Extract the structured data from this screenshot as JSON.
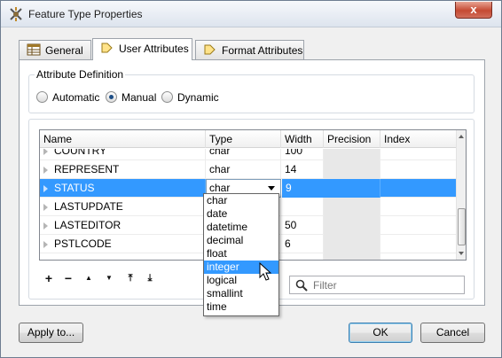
{
  "window": {
    "title": "Feature Type Properties",
    "close_glyph": "x"
  },
  "tabs": [
    {
      "label": "General",
      "icon": "table-icon"
    },
    {
      "label": "User Attributes",
      "icon": "attribute-arrow-icon",
      "active": true
    },
    {
      "label": "Format Attributes",
      "icon": "attribute-arrow-icon"
    }
  ],
  "attribute_definition": {
    "title": "Attribute Definition",
    "options": [
      {
        "label": "Automatic",
        "selected": false
      },
      {
        "label": "Manual",
        "selected": true
      },
      {
        "label": "Dynamic",
        "selected": false
      }
    ]
  },
  "grid": {
    "columns": [
      "Name",
      "Type",
      "Width",
      "Precision",
      "Index"
    ],
    "rows": [
      {
        "name": "COUNTRY",
        "type": "char",
        "width": "100",
        "precision": "",
        "index": ""
      },
      {
        "name": "REPRESENT",
        "type": "char",
        "width": "14",
        "precision": "",
        "index": ""
      },
      {
        "name": "STATUS",
        "type": "char",
        "width": "9",
        "precision": "",
        "index": "",
        "selected": true
      },
      {
        "name": "LASTUPDATE",
        "type": "",
        "width": "",
        "precision": "",
        "index": ""
      },
      {
        "name": "LASTEDITOR",
        "type": "",
        "width": "50",
        "precision": "",
        "index": ""
      },
      {
        "name": "PSTLCODE",
        "type": "",
        "width": "6",
        "precision": "",
        "index": ""
      },
      {
        "name": "",
        "type": "",
        "width": "",
        "precision": "",
        "index": ""
      }
    ]
  },
  "type_dropdown": {
    "options": [
      "char",
      "date",
      "datetime",
      "decimal",
      "float",
      "integer",
      "logical",
      "smallint",
      "time"
    ],
    "highlighted": "integer"
  },
  "toolbar": {
    "add": "+",
    "remove": "−",
    "up": "▲",
    "down": "▼",
    "top": "⤒",
    "bottom": "⤓"
  },
  "filter": {
    "placeholder": "Filter",
    "value": ""
  },
  "buttons": {
    "apply_to": "Apply to...",
    "ok": "OK",
    "cancel": "Cancel"
  },
  "colors": {
    "selection": "#3399ff",
    "title_bar": "#dde4ee",
    "close_button": "#c54a33"
  }
}
